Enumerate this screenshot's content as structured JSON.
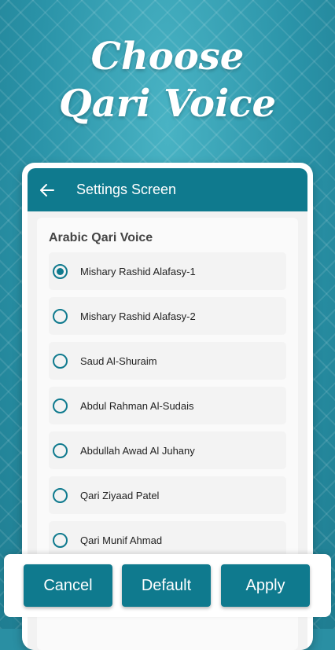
{
  "headline": {
    "line1": "Choose",
    "line2": "Qari Voice"
  },
  "appbar": {
    "title": "Settings Screen",
    "back_icon": "arrow-left-icon"
  },
  "section": {
    "title": "Arabic Qari Voice"
  },
  "voices": [
    {
      "label": "Mishary Rashid Alafasy-1",
      "selected": true
    },
    {
      "label": "Mishary Rashid Alafasy-2",
      "selected": false
    },
    {
      "label": "Saud Al-Shuraim",
      "selected": false
    },
    {
      "label": "Abdul Rahman Al-Sudais",
      "selected": false
    },
    {
      "label": "Abdullah Awad Al Juhany",
      "selected": false
    },
    {
      "label": "Qari Ziyaad Patel",
      "selected": false
    },
    {
      "label": "Qari Munif Ahmad",
      "selected": false
    }
  ],
  "buttons": {
    "cancel": "Cancel",
    "default": "Default",
    "apply": "Apply"
  },
  "colors": {
    "primary": "#0f7a8e",
    "background": "#2a8fa3"
  }
}
